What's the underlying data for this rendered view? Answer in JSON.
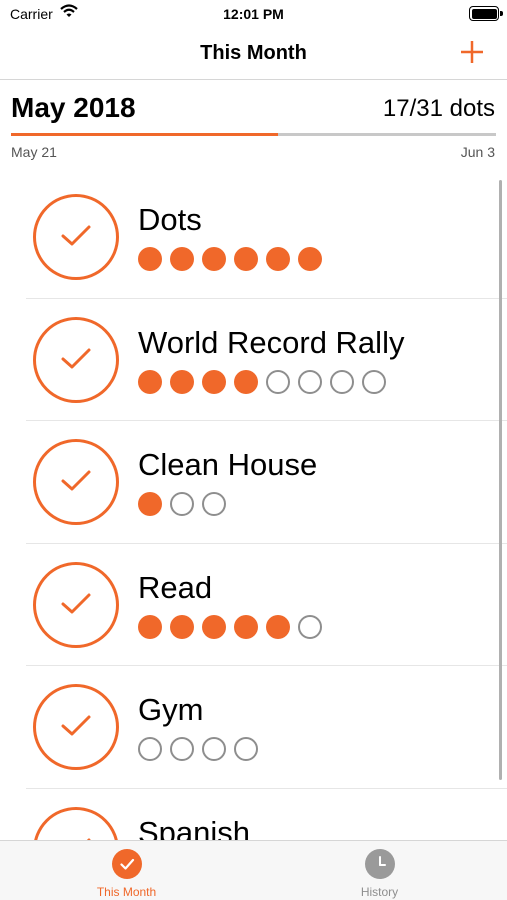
{
  "status_bar": {
    "carrier": "Carrier",
    "time": "12:01 PM"
  },
  "nav": {
    "title": "This Month",
    "add_icon": "plus-icon"
  },
  "month": {
    "title": "May 2018",
    "dots_count": "17/31 dots",
    "progress_fraction": 0.55,
    "range_start": "May 21",
    "range_end": "Jun 3"
  },
  "habits": [
    {
      "name": "Dots",
      "dots": [
        1,
        1,
        1,
        1,
        1,
        1
      ]
    },
    {
      "name": "World Record Rally",
      "dots": [
        1,
        1,
        1,
        1,
        0,
        0,
        0,
        0
      ]
    },
    {
      "name": "Clean House",
      "dots": [
        1,
        0,
        0
      ]
    },
    {
      "name": "Read",
      "dots": [
        1,
        1,
        1,
        1,
        1,
        0
      ]
    },
    {
      "name": "Gym",
      "dots": [
        0,
        0,
        0,
        0
      ]
    },
    {
      "name": "Spanish",
      "dots": []
    }
  ],
  "tabs": [
    {
      "label": "This Month",
      "icon": "check-circle-icon",
      "active": true
    },
    {
      "label": "History",
      "icon": "clock-icon",
      "active": false
    }
  ],
  "colors": {
    "accent": "#f0682a",
    "inactive": "#8e8e8e"
  }
}
